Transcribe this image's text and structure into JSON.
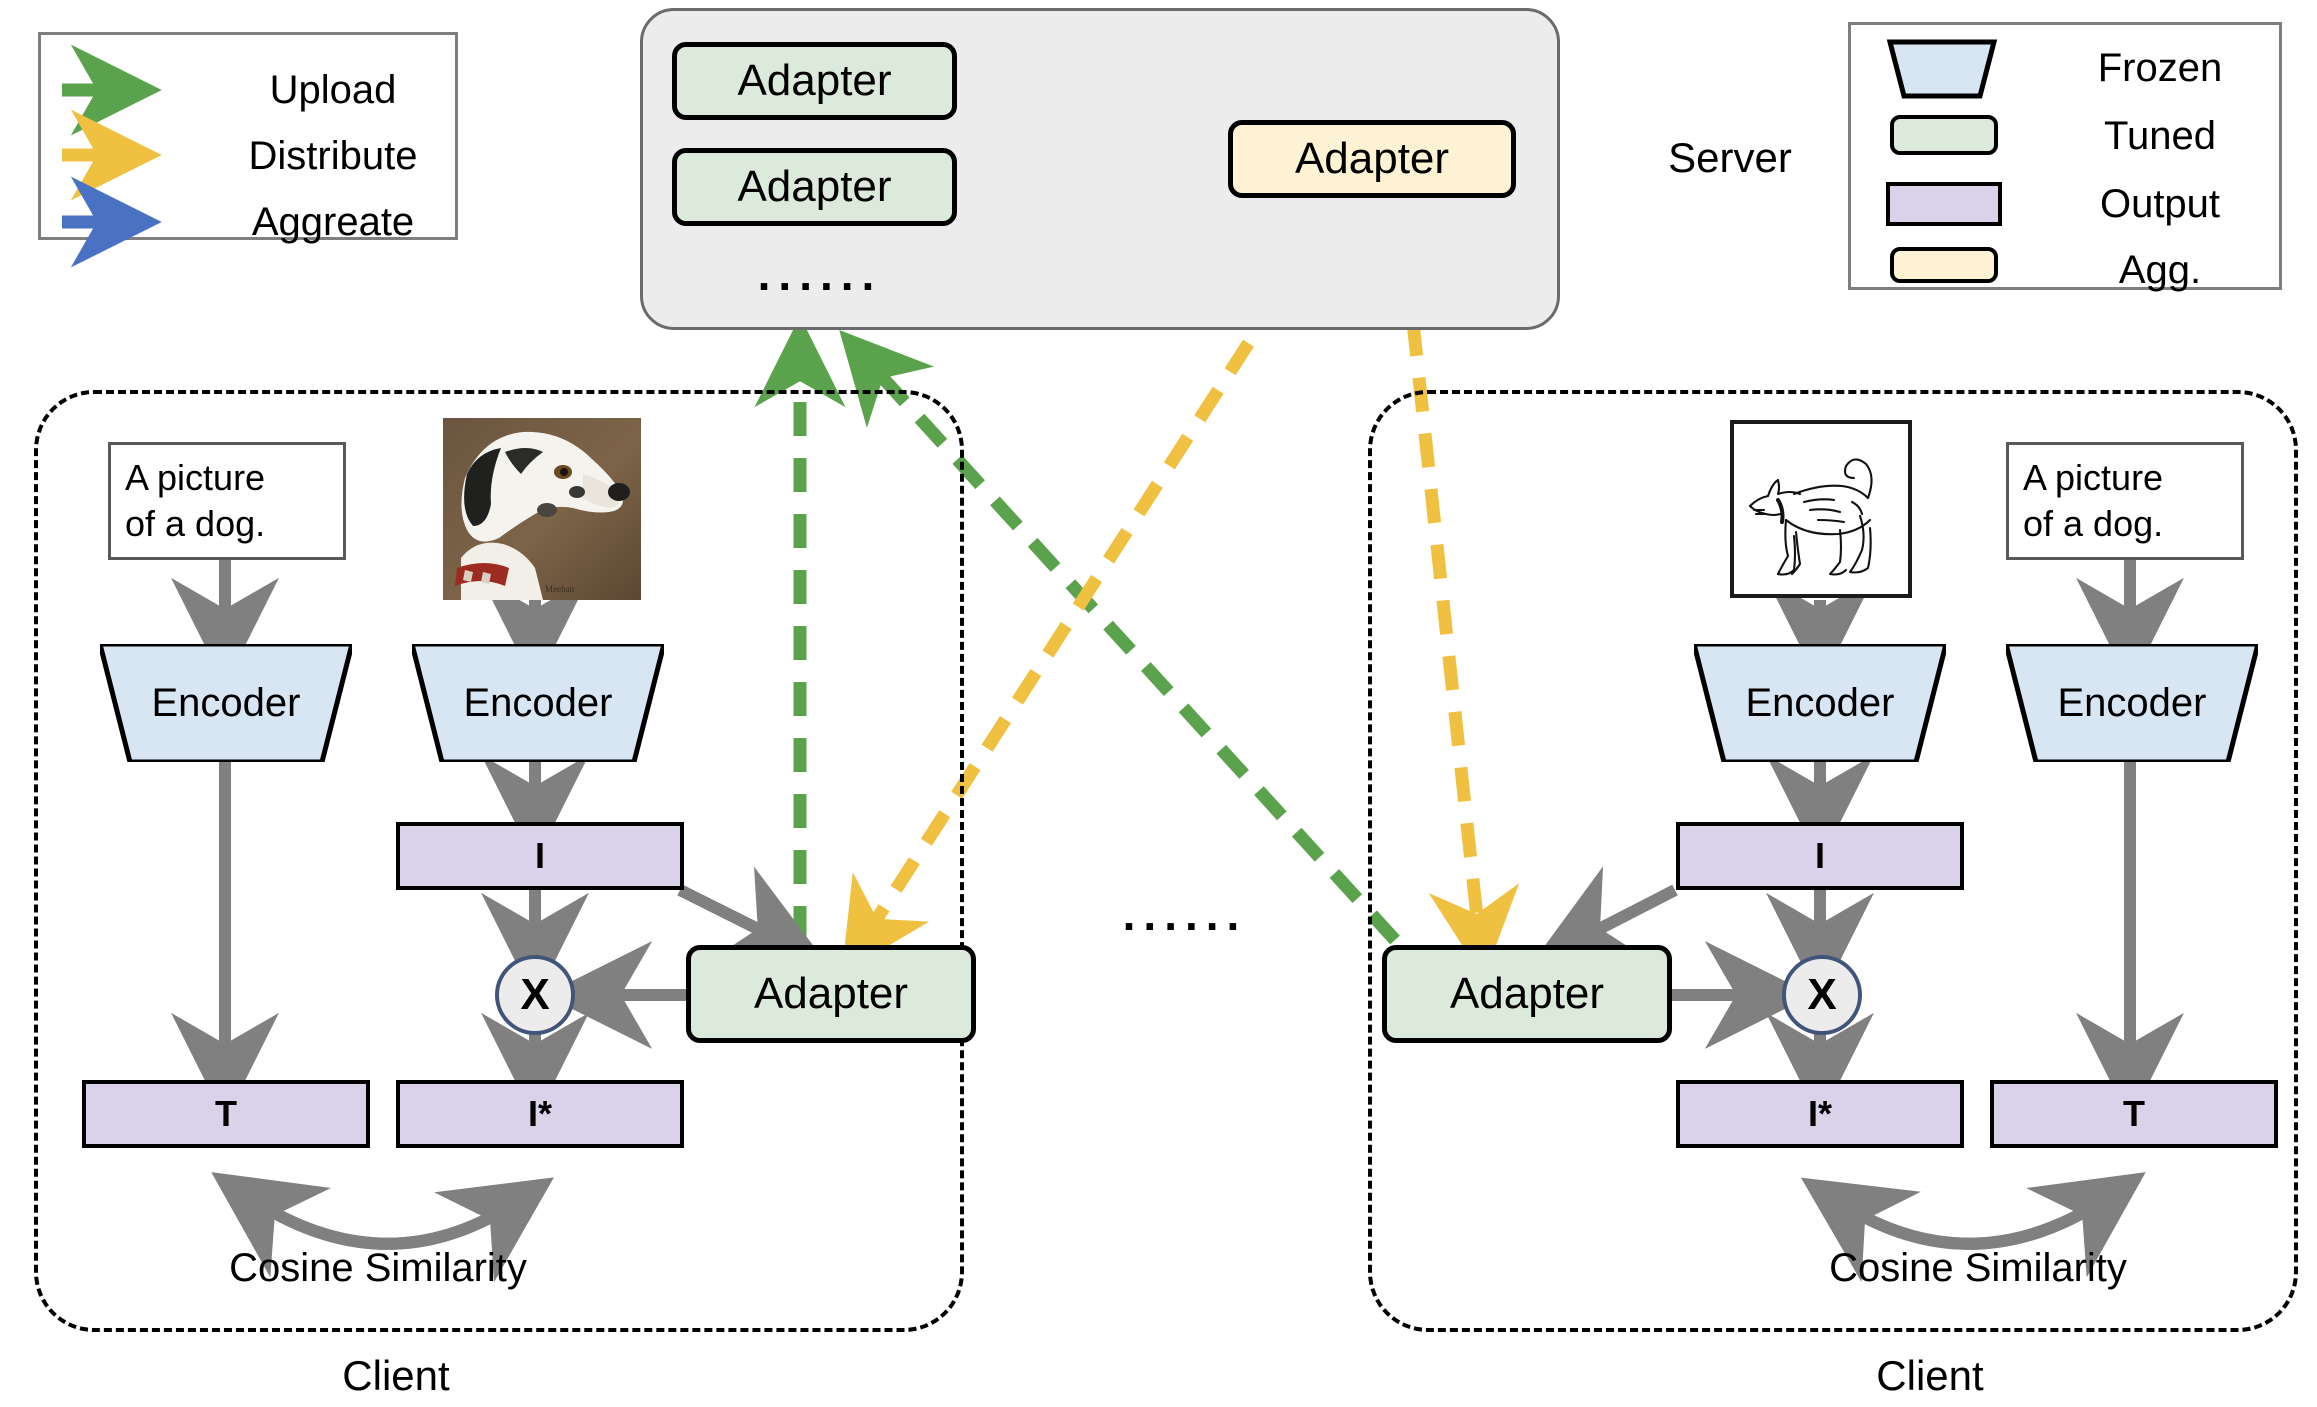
{
  "legend_flows": {
    "title": "flow-legend",
    "items": [
      {
        "label": "Upload",
        "color": "#5aa24b",
        "icon": "arrow-right-icon"
      },
      {
        "label": "Distribute",
        "color": "#f0c040",
        "icon": "arrow-right-icon"
      },
      {
        "label": "Aggreate",
        "color": "#4a72c4",
        "icon": "arrow-right-icon"
      }
    ]
  },
  "legend_shapes": {
    "title": "shape-legend",
    "items": [
      {
        "label": "Frozen",
        "shape": "trapezoid",
        "color": "#d8e5f3"
      },
      {
        "label": "Tuned",
        "shape": "rounded-rect",
        "color": "#dceadb"
      },
      {
        "label": "Output",
        "shape": "rect",
        "color": "#d9d2e9"
      },
      {
        "label": "Agg.",
        "shape": "rounded-rect",
        "color": "#fdf3d4"
      }
    ]
  },
  "server": {
    "label": "Server",
    "client_adapters": [
      "Adapter",
      "Adapter"
    ],
    "ellipsis": "......",
    "aggregated_adapter": "Adapter"
  },
  "middle_ellipsis": "......",
  "clients": [
    {
      "name": "Client",
      "text_prompt": "A picture\nof a dog.",
      "image_caption": "dog-photo",
      "text_encoder": "Encoder",
      "image_encoder": "Encoder",
      "image_feature": "I",
      "adapter": "Adapter",
      "mul_node": "X",
      "text_output": "T",
      "image_output": "I*",
      "similarity": "Cosine Similarity"
    },
    {
      "name": "Client",
      "text_prompt": "A picture\nof a dog.",
      "image_caption": "dog-sketch",
      "text_encoder": "Encoder",
      "image_encoder": "Encoder",
      "image_feature": "I",
      "adapter": "Adapter",
      "mul_node": "X",
      "text_output": "T",
      "image_output": "I*",
      "similarity": "Cosine Similarity"
    }
  ],
  "colors": {
    "upload": "#5aa24b",
    "distribute": "#f0c040",
    "aggregate": "#4a72c4",
    "frozen": "#d8e5f3",
    "tuned": "#dceadb",
    "output": "#d9d2e9",
    "agg": "#fdf3d4",
    "arrow_gray": "#808080",
    "server_bg": "#ececec"
  }
}
